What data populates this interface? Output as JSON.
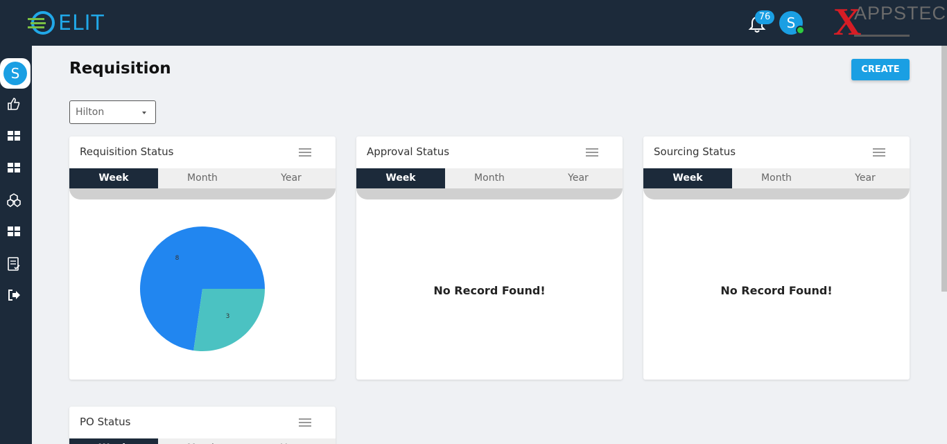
{
  "app": {
    "logo_text": "ELIT",
    "brand_text": "APPSTEC",
    "notification_count": "76",
    "user_initial": "S"
  },
  "colors": {
    "topbar": "#1c2a3a",
    "accent": "#1a9fe3",
    "pie_primary": "#2186f0",
    "pie_secondary": "#4bc2c2",
    "online": "#2ecc40"
  },
  "sidebar": {
    "avatar_initial": "S",
    "icons": [
      "thumbs-up-icon",
      "dashboard-grid-icon",
      "dashboard-grid-icon",
      "cubes-icon",
      "dashboard-grid-icon",
      "checklist-icon",
      "sign-out-icon"
    ]
  },
  "page": {
    "title": "Requisition",
    "create_label": "CREATE",
    "filter_value": "Hilton"
  },
  "cards": [
    {
      "title": "Requisition Status",
      "tabs": [
        "Week",
        "Month",
        "Year"
      ],
      "active_tab": "Week"
    },
    {
      "title": "Approval Status",
      "tabs": [
        "Week",
        "Month",
        "Year"
      ],
      "active_tab": "Week",
      "empty_text": "No Record Found!"
    },
    {
      "title": "Sourcing Status",
      "tabs": [
        "Week",
        "Month",
        "Year"
      ],
      "active_tab": "Week",
      "empty_text": "No Record Found!"
    },
    {
      "title": "PO Status",
      "tabs": [
        "Week",
        "Month",
        "Year"
      ],
      "active_tab": "Week"
    }
  ],
  "chart_data": {
    "type": "pie",
    "values": [
      8,
      3
    ],
    "data_labels": [
      "8",
      "3"
    ],
    "title": "",
    "colors": [
      "#2186f0",
      "#4bc2c2"
    ]
  }
}
